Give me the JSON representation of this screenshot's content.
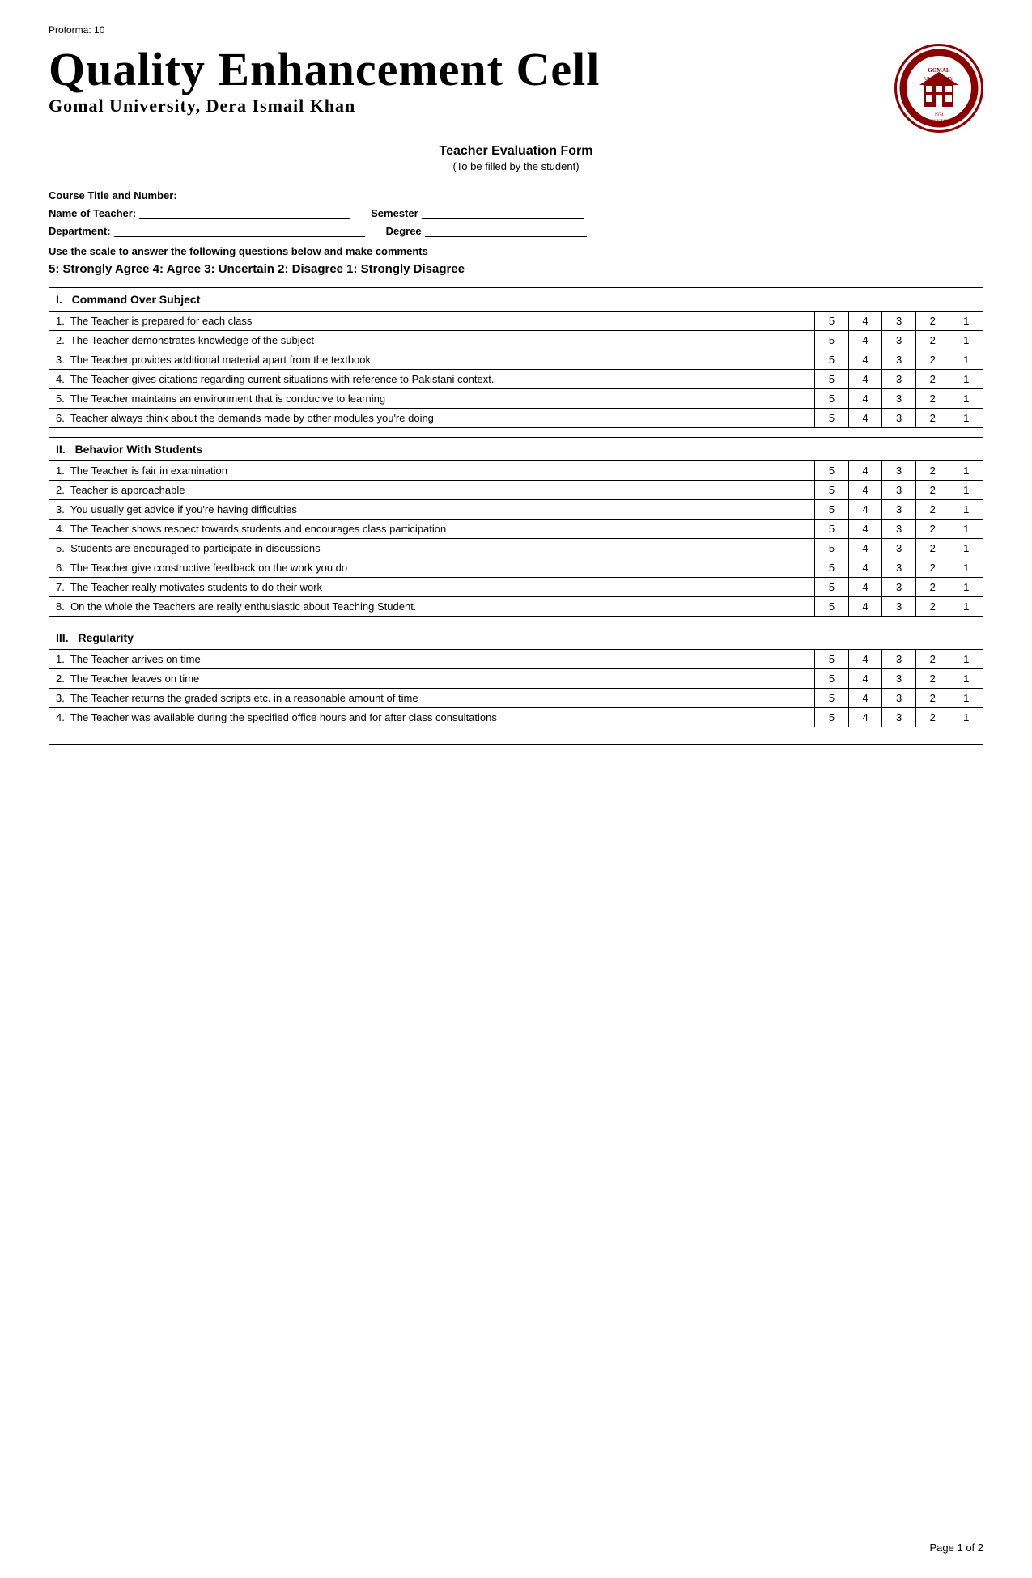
{
  "proforma": "Proforma: 10",
  "title": "Quality Enhancement Cell",
  "subtitle": "Gomal University, Dera Ismail Khan",
  "form_title": "Teacher Evaluation Form",
  "form_subtitle": "(To be filled by the student)",
  "fields": {
    "course_title_label": "Course Title and Number:",
    "teacher_label": "Name of Teacher:",
    "semester_label": "Semester",
    "department_label": "Department:",
    "degree_label": "Degree"
  },
  "instruction": "Use the scale to answer the following questions below and make comments",
  "scale": "5: Strongly Agree    4: Agree    3: Uncertain    2: Disagree    1: Strongly Disagree",
  "sections": [
    {
      "id": "I",
      "title": "Command Over Subject",
      "questions": [
        {
          "num": "1.",
          "text": "The Teacher is prepared for each class"
        },
        {
          "num": "2.",
          "text": "The Teacher demonstrates knowledge of the subject"
        },
        {
          "num": "3.",
          "text": "The Teacher provides additional material apart from the textbook"
        },
        {
          "num": "4.",
          "text": "The Teacher gives citations regarding current situations with reference to Pakistani context."
        },
        {
          "num": "5.",
          "text": "The Teacher maintains an environment that is conducive to learning"
        },
        {
          "num": "6.",
          "text": "Teacher always think about the demands made by other modules you're doing"
        }
      ]
    },
    {
      "id": "II",
      "title": "Behavior With Students",
      "questions": [
        {
          "num": "1.",
          "text": "The Teacher is fair in examination"
        },
        {
          "num": "2.",
          "text": "Teacher is approachable"
        },
        {
          "num": "3.",
          "text": "You usually get advice if you're having difficulties"
        },
        {
          "num": "4.",
          "text": "The Teacher shows respect towards students and encourages class participation"
        },
        {
          "num": "5.",
          "text": "Students are encouraged to participate in discussions"
        },
        {
          "num": "6.",
          "text": "The Teacher give constructive feedback on the work you do"
        },
        {
          "num": "7.",
          "text": "The Teacher really motivates students to do their  work"
        },
        {
          "num": "8.",
          "text": "On the whole the Teachers are really enthusiastic about Teaching Student."
        }
      ]
    },
    {
      "id": "III",
      "title": "Regularity",
      "questions": [
        {
          "num": "1.",
          "text": "The Teacher arrives on time"
        },
        {
          "num": "2.",
          "text": "The Teacher leaves on time"
        },
        {
          "num": "3.",
          "text": "The Teacher returns the graded scripts etc. in  a reasonable amount of time"
        },
        {
          "num": "4.",
          "text": "The Teacher was available during the specified office hours and for after class consultations"
        }
      ]
    }
  ],
  "ratings": [
    "5",
    "4",
    "3",
    "2",
    "1"
  ],
  "page": "Page 1 of 2"
}
